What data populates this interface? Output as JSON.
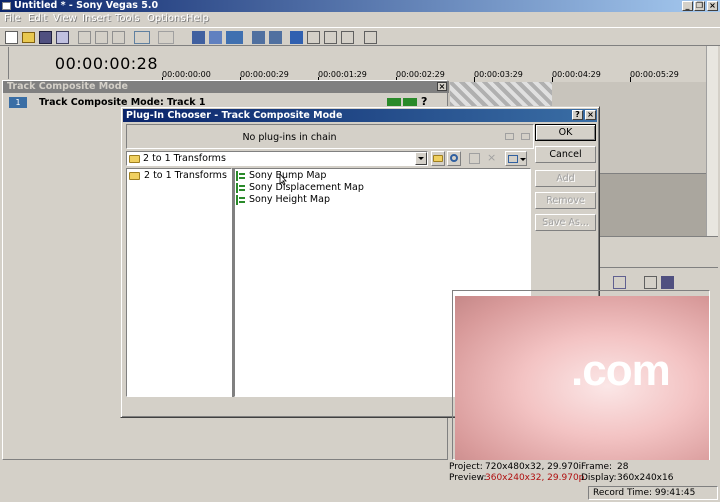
{
  "app": {
    "title": "Untitled * - Sony Vegas 5.0"
  },
  "menu": [
    {
      "label": "File"
    },
    {
      "label": "Edit"
    },
    {
      "label": "View"
    },
    {
      "label": "Insert"
    },
    {
      "label": "Tools"
    },
    {
      "label": "Options"
    },
    {
      "label": "Help"
    }
  ],
  "window_controls": {
    "minimize": "_",
    "restore": "❐",
    "close": "×"
  },
  "timeline": {
    "time_readout": "00:00:00:28",
    "ruler_labels": [
      "00:00:00:00",
      "00:00:00:29",
      "00:00:01:29",
      "00:00:02:29",
      "00:00:03:29",
      "00:00:04:29",
      "00:00:05:29"
    ]
  },
  "track_panel": {
    "header": "Track Composite Mode",
    "close_label": "×",
    "track_number": "1",
    "label": "Track Composite Mode: Track 1",
    "help": "?"
  },
  "dialog": {
    "title": "Plug-In Chooser - Track Composite Mode",
    "help_btn": "?",
    "close_btn": "×",
    "chain_text": "No plug-ins in chain",
    "buttons": {
      "ok": "OK",
      "cancel": "Cancel",
      "add": "Add",
      "remove": "Remove",
      "save_as": "Save As..."
    },
    "path": "2 to 1 Transforms",
    "tree": [
      {
        "label": "2 to 1 Transforms"
      }
    ],
    "plugins": [
      {
        "label": "Sony Bump Map"
      },
      {
        "label": "Sony Displacement Map"
      },
      {
        "label": "Sony Height Map"
      }
    ]
  },
  "preview": {
    "image_text": ".com",
    "project_label": "Project:",
    "project_value": "720x480x32, 29.970i",
    "preview_label": "Preview:",
    "preview_value": "360x240x32, 29.970p",
    "frame_label": "Frame:",
    "frame_value": "28",
    "display_label": "Display:",
    "display_value": "360x240x16",
    "record_time": "Record Time: 99:41:45"
  },
  "colors": {
    "title_active": "#0a246a",
    "face": "#d4d0c8",
    "disabled_text": "#a0a0a0"
  }
}
